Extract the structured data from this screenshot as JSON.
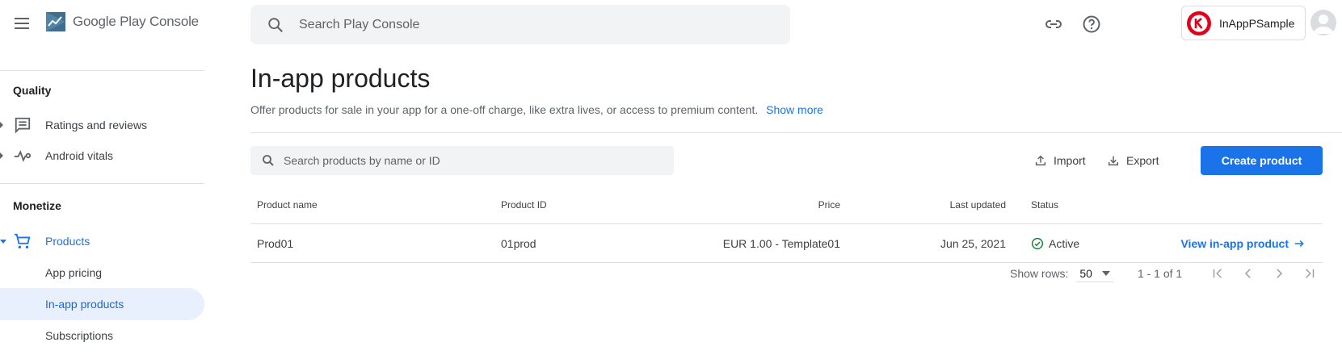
{
  "header": {
    "brand_google": "Google Play",
    "brand_console": "Console",
    "search_placeholder": "Search Play Console",
    "app_name": "InAppPSample",
    "icons": [
      "menu-icon",
      "play-console-logo-icon",
      "search-icon",
      "link-icon",
      "help-icon",
      "app-icon",
      "account-avatar-icon"
    ]
  },
  "sidebar": {
    "quality_section": "Quality",
    "monetize_section": "Monetize",
    "items": [
      {
        "label": "Ratings and reviews",
        "icon": "reviews-icon"
      },
      {
        "label": "Android vitals",
        "icon": "vitals-icon"
      },
      {
        "label": "Products",
        "icon": "cart-icon"
      },
      {
        "label": "App pricing"
      },
      {
        "label": "In-app products"
      },
      {
        "label": "Subscriptions"
      }
    ],
    "selected": "In-app products"
  },
  "main": {
    "title": "In-app products",
    "description": "Offer products for sale in your app for a one-off charge, like extra lives, or access to premium content.",
    "show_more": "Show more",
    "search_placeholder": "Search products by name or ID",
    "import_label": "Import",
    "export_label": "Export",
    "create_label": "Create product",
    "table": {
      "columns": [
        "Product name",
        "Product ID",
        "Price",
        "Last updated",
        "Status"
      ],
      "rows": [
        {
          "name": "Prod01",
          "id": "01prod",
          "price": "EUR 1.00 - Template01",
          "updated": "Jun 25, 2021",
          "status": "Active",
          "link": "View in-app product"
        }
      ]
    },
    "pagination": {
      "show_rows_label": "Show rows:",
      "rows_value": "50",
      "range": "1 - 1 of 1"
    }
  },
  "colors": {
    "accent": "#1a73e8",
    "selected_bg": "#e8f0fe",
    "active_green": "#188038",
    "app_icon_red": "#e2001a"
  }
}
